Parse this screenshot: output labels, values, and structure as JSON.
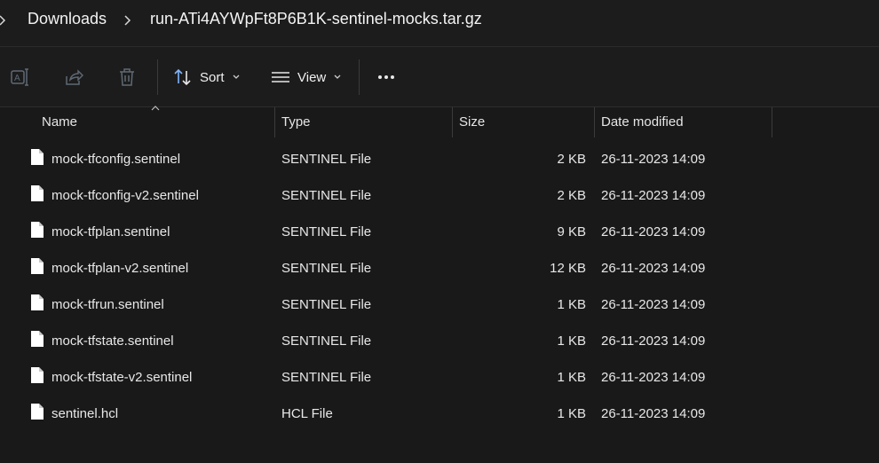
{
  "breadcrumb": {
    "items": [
      "Downloads",
      "run-ATi4AYWpFt8P6B1K-sentinel-mocks.tar.gz"
    ]
  },
  "toolbar": {
    "sort_label": "Sort",
    "view_label": "View",
    "icons": [
      "rename-icon",
      "share-icon",
      "delete-icon",
      "sort-icon",
      "view-icon",
      "more-icon"
    ]
  },
  "columns": {
    "name": "Name",
    "type": "Type",
    "size": "Size",
    "date": "Date modified"
  },
  "files": [
    {
      "name": "mock-tfconfig.sentinel",
      "type": "SENTINEL File",
      "size": "2 KB",
      "date": "26-11-2023 14:09"
    },
    {
      "name": "mock-tfconfig-v2.sentinel",
      "type": "SENTINEL File",
      "size": "2 KB",
      "date": "26-11-2023 14:09"
    },
    {
      "name": "mock-tfplan.sentinel",
      "type": "SENTINEL File",
      "size": "9 KB",
      "date": "26-11-2023 14:09"
    },
    {
      "name": "mock-tfplan-v2.sentinel",
      "type": "SENTINEL File",
      "size": "12 KB",
      "date": "26-11-2023 14:09"
    },
    {
      "name": "mock-tfrun.sentinel",
      "type": "SENTINEL File",
      "size": "1 KB",
      "date": "26-11-2023 14:09"
    },
    {
      "name": "mock-tfstate.sentinel",
      "type": "SENTINEL File",
      "size": "1 KB",
      "date": "26-11-2023 14:09"
    },
    {
      "name": "mock-tfstate-v2.sentinel",
      "type": "SENTINEL File",
      "size": "1 KB",
      "date": "26-11-2023 14:09"
    },
    {
      "name": "sentinel.hcl",
      "type": "HCL File",
      "size": "1 KB",
      "date": "26-11-2023 14:09"
    }
  ],
  "colors": {
    "background": "#191919",
    "toolbar": "#1c1c1c",
    "text": "#e8e8e8",
    "disabled_icon": "#5f6a75"
  }
}
